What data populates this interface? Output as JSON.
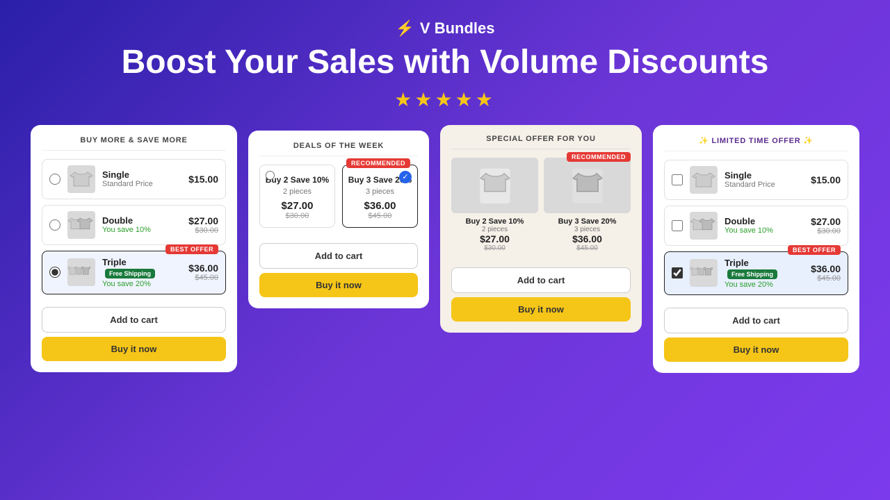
{
  "header": {
    "logo_icon": "⚡",
    "logo_text": "V Bundles",
    "headline": "Boost Your Sales with Volume Discounts",
    "stars": "★★★★★"
  },
  "card1": {
    "title": "BUY MORE & SAVE MORE",
    "options": [
      {
        "name": "Single",
        "sub": "Standard Price",
        "sub_class": "",
        "price": "$15.00",
        "old_price": "",
        "selected": false,
        "badge": "",
        "free_shipping": false
      },
      {
        "name": "Double",
        "sub": "You save 10%",
        "sub_class": "green",
        "price": "$27.00",
        "old_price": "$30.00",
        "selected": false,
        "badge": "",
        "free_shipping": false
      },
      {
        "name": "Triple",
        "sub": "You save 20%",
        "sub_class": "green",
        "price": "$36.00",
        "old_price": "$45.00",
        "selected": true,
        "badge": "BEST OFFER",
        "free_shipping": true
      }
    ],
    "add_to_cart": "Add to cart",
    "buy_now": "Buy it now"
  },
  "card2": {
    "title": "DEALS OF THE WEEK",
    "options": [
      {
        "label": "Buy 2 Save 10%",
        "pieces": "2 pieces",
        "price": "$27.00",
        "old_price": "$30.00",
        "selected": false,
        "badge": ""
      },
      {
        "label": "Buy 3 Save 20%",
        "pieces": "3 pieces",
        "price": "$36.00",
        "old_price": "$45.00",
        "selected": true,
        "badge": "RECOMMENDED"
      }
    ],
    "add_to_cart": "Add to cart",
    "buy_now": "Buy it now"
  },
  "card3": {
    "title": "SPECIAL OFFER FOR YOU",
    "products": [
      {
        "label": "Buy 2 Save 10%",
        "pieces": "2 pieces",
        "price": "$27.00",
        "old_price": "$30.00",
        "badge": ""
      },
      {
        "label": "Buy 3 Save 20%",
        "pieces": "3 pieces",
        "price": "$36.00",
        "old_price": "$45.00",
        "badge": "RECOMMENDED"
      }
    ],
    "add_to_cart": "Add to cart",
    "buy_now": "Buy it now"
  },
  "card4": {
    "title": "✨ LIMITED TIME OFFER ✨",
    "options": [
      {
        "name": "Single",
        "sub": "Standard Price",
        "sub_class": "",
        "price": "$15.00",
        "old_price": "",
        "selected": false,
        "badge": "",
        "free_shipping": false
      },
      {
        "name": "Double",
        "sub": "You save 10%",
        "sub_class": "green",
        "price": "$27.00",
        "old_price": "$30.00",
        "selected": false,
        "badge": "",
        "free_shipping": false
      },
      {
        "name": "Triple",
        "sub": "You save 20%",
        "sub_class": "green",
        "price": "$36.00",
        "old_price": "$45.00",
        "selected": true,
        "badge": "BEST OFFER",
        "free_shipping": true
      }
    ],
    "add_to_cart": "Add to cart",
    "buy_now": "Buy it now"
  }
}
